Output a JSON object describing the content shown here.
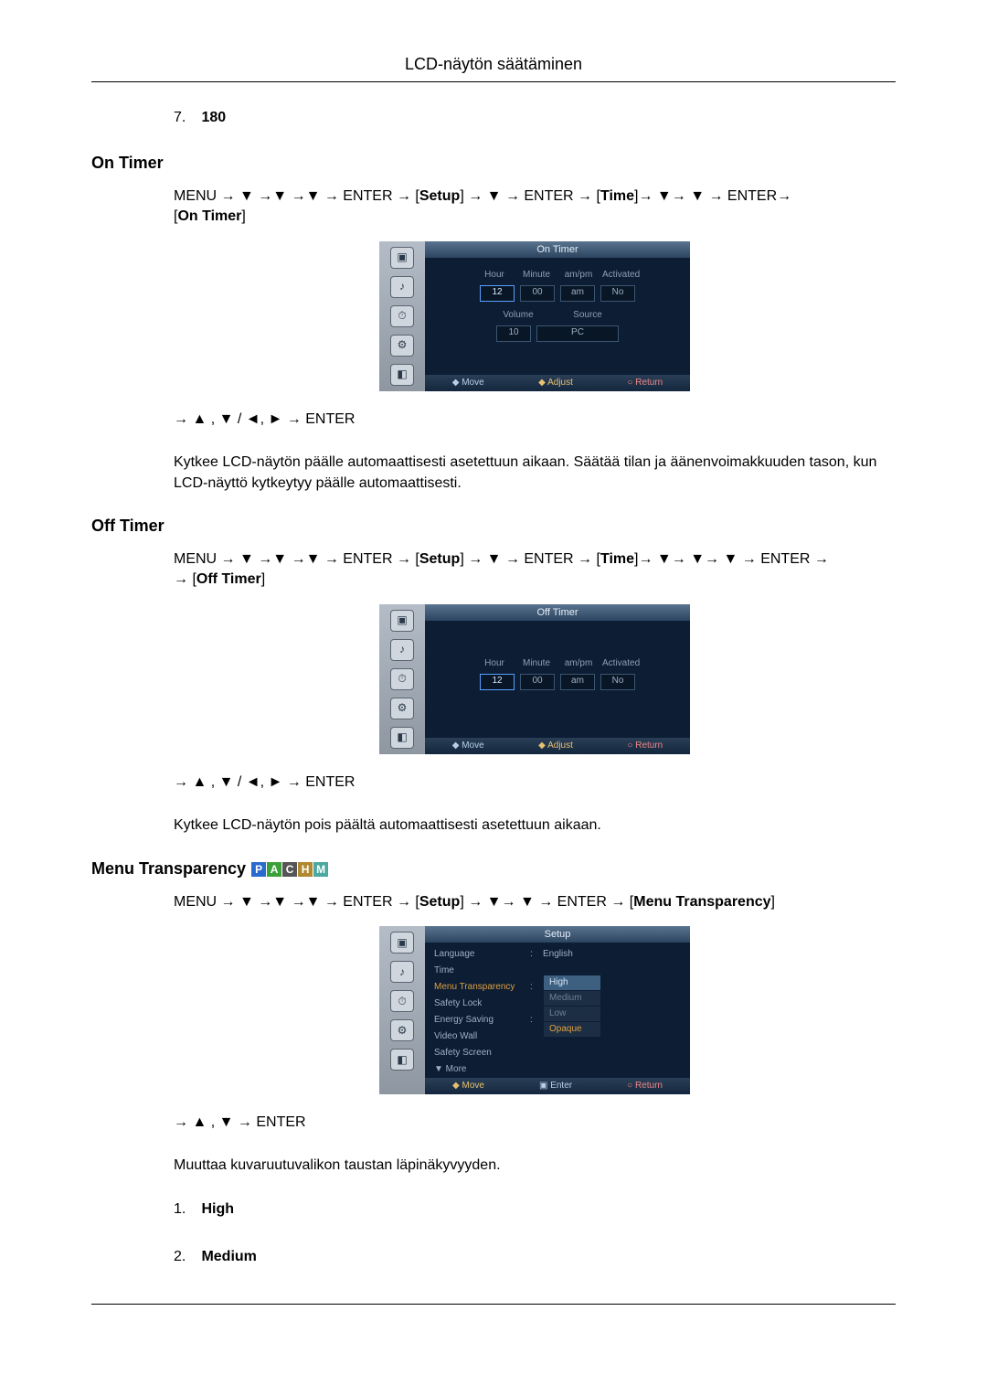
{
  "header": {
    "title": "LCD-näytön säätäminen"
  },
  "preceding_item": {
    "num": "7.",
    "label": "180"
  },
  "sections": {
    "on_timer": {
      "heading": "On Timer",
      "nav": {
        "prefix": "MENU → ▼ →▼ →▼ → ENTER → ",
        "setup": "Setup",
        "mid1": " → ▼ → ENTER → ",
        "time": "Time",
        "mid2": "→ ▼→ ▼ → ENTER→",
        "target": "On Timer"
      },
      "osd": {
        "title": "On Timer",
        "headers": [
          "Hour",
          "Minute",
          "am/pm",
          "Activated"
        ],
        "values": [
          "12",
          "00",
          "am",
          "No"
        ],
        "row2_labels": [
          "Volume",
          "Source"
        ],
        "row2_values": [
          "10",
          "PC"
        ],
        "footer": {
          "move": "Move",
          "adjust": "Adjust",
          "return": "Return"
        }
      },
      "keys": "→ ▲ , ▼ / ◄, ► → ENTER",
      "desc": "Kytkee LCD-näytön päälle automaattisesti asetettuun aikaan. Säätää tilan ja äänenvoimakkuuden tason, kun LCD-näyttö kytkeytyy päälle automaattisesti."
    },
    "off_timer": {
      "heading": "Off Timer",
      "nav": {
        "prefix": "MENU → ▼ →▼ →▼ → ENTER → ",
        "setup": "Setup",
        "mid1": " → ▼ → ENTER → ",
        "time": "Time",
        "mid2": "→ ▼→ ▼→ ▼ → ENTER → ",
        "target": "Off Timer"
      },
      "osd": {
        "title": "Off Timer",
        "headers": [
          "Hour",
          "Minute",
          "am/pm",
          "Activated"
        ],
        "values": [
          "12",
          "00",
          "am",
          "No"
        ],
        "footer": {
          "move": "Move",
          "adjust": "Adjust",
          "return": "Return"
        }
      },
      "keys": "→ ▲ , ▼ / ◄, ► → ENTER",
      "desc": "Kytkee LCD-näytön pois päältä automaattisesti asetettuun aikaan."
    },
    "menu_transparency": {
      "heading": "Menu Transparency",
      "badges": {
        "p": "P",
        "a": "A",
        "c": "C",
        "h": "H",
        "m": "M"
      },
      "nav": {
        "prefix": "MENU → ▼ →▼ →▼ → ENTER → ",
        "setup": "Setup",
        "mid1": " → ▼→ ▼ → ENTER → ",
        "target": "Menu Transparency"
      },
      "osd": {
        "title": "Setup",
        "items": [
          {
            "label": "Language",
            "value": "English"
          },
          {
            "label": "Time",
            "value": ""
          },
          {
            "label": "Menu Transparency",
            "value": "",
            "highlight": true
          },
          {
            "label": "Safety Lock",
            "value": ""
          },
          {
            "label": "Energy Saving",
            "value": ""
          },
          {
            "label": "Video Wall",
            "value": ""
          },
          {
            "label": "Safety Screen",
            "value": ""
          },
          {
            "label": "▼ More",
            "value": ""
          }
        ],
        "options": [
          "High",
          "Medium",
          "Low",
          "Opaque"
        ],
        "footer": {
          "move": "Move",
          "enter": "Enter",
          "return": "Return"
        }
      },
      "keys": "→ ▲ , ▼ → ENTER",
      "desc": "Muuttaa kuvaruutuvalikon taustan läpinäkyvyyden.",
      "list": [
        {
          "num": "1.",
          "label": "High"
        },
        {
          "num": "2.",
          "label": "Medium"
        }
      ]
    }
  }
}
